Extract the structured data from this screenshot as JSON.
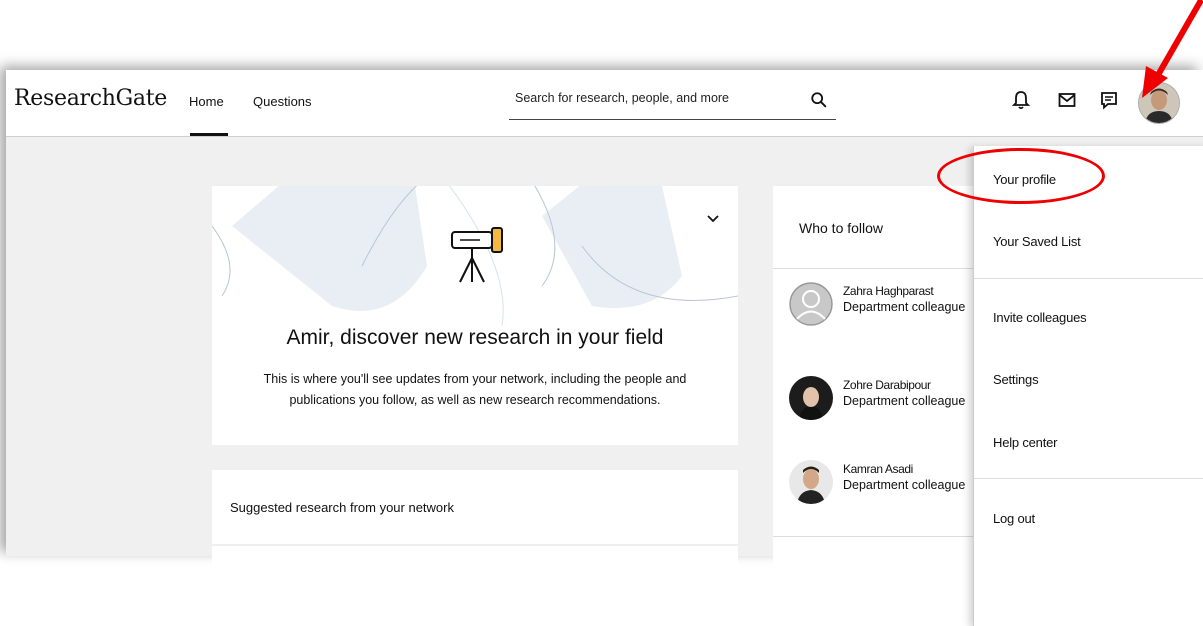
{
  "app": {
    "logo": "ResearchGate"
  },
  "nav": {
    "home": "Home",
    "questions": "Questions"
  },
  "search": {
    "placeholder": "Search for research, people, and more"
  },
  "icons": {
    "search": "search-icon",
    "notifications": "bell-icon",
    "messages": "mail-icon",
    "requests": "chat-icon",
    "chevron": "chevron-down-icon"
  },
  "hero": {
    "title": "Amir, discover new research in your field",
    "text": "This is where you'll see updates from your network, including the people and publications you follow, as well as new research recommendations."
  },
  "suggested": {
    "label": "Suggested research from your network"
  },
  "who_to_follow": {
    "title": "Who to follow",
    "people": [
      {
        "name": "Zahra Haghparast",
        "role": "Department colleague"
      },
      {
        "name": "Zohre Darabipour",
        "role": "Department colleague"
      },
      {
        "name": "Kamran Asadi",
        "role": "Department colleague"
      }
    ]
  },
  "menu": {
    "items": [
      "Your profile",
      "Your Saved List",
      "Invite colleagues",
      "Settings",
      "Help center",
      "Log out"
    ]
  },
  "colors": {
    "annotation": "#e00000",
    "background": "#f0f0f0",
    "accent_decor": "#dbe7f2"
  }
}
